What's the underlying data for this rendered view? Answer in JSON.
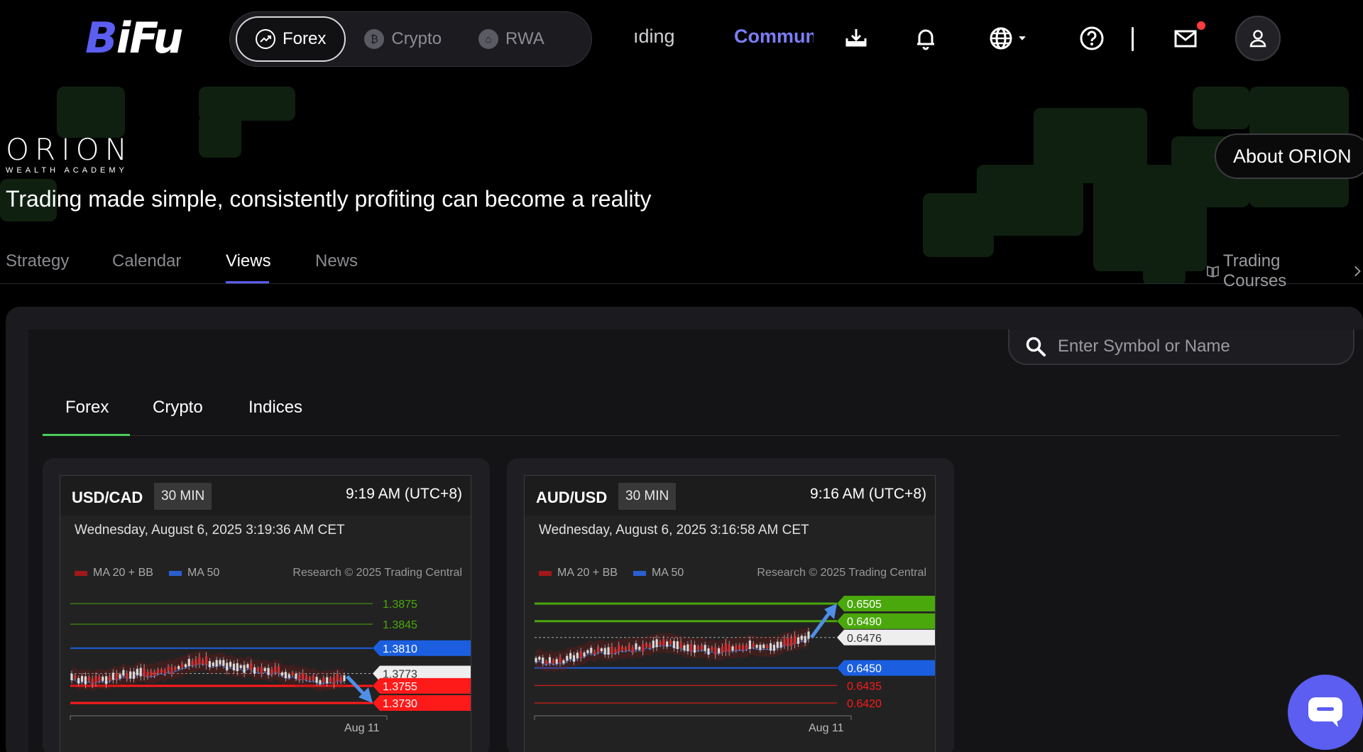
{
  "brand": {
    "logo_text_a": "B",
    "logo_text_b": "iFu"
  },
  "market_switch": [
    {
      "label": "Forex",
      "icon": "trend-icon",
      "active": true
    },
    {
      "label": "Crypto",
      "icon": "bitcoin-icon",
      "active": false
    },
    {
      "label": "RWA",
      "icon": "house-icon",
      "active": false
    }
  ],
  "nav": {
    "trading": "ıding",
    "community": "Commun"
  },
  "hero": {
    "org_name": "ORION",
    "org_sub": "WEALTH ACADEMY",
    "tagline": "Trading made simple, consistently profiting can become a reality",
    "about_button": "About ORION"
  },
  "subtabs": [
    "Strategy",
    "Calendar",
    "Views",
    "News"
  ],
  "subtab_active": "Views",
  "courses_link": "Trading Courses",
  "search": {
    "placeholder": "Enter Symbol or Name"
  },
  "category_tabs": [
    "Forex",
    "Crypto",
    "Indices"
  ],
  "category_active": "Forex",
  "cards": [
    {
      "symbol": "USD/CAD",
      "timeframe": "30 MIN",
      "time": "9:19 AM (UTC+8)",
      "date": "Wednesday, August 6, 2025 3:19:36 AM CET",
      "legend_a": "MA 20 + BB",
      "legend_b": "MA 50",
      "credit": "Research © 2025 Trading Central",
      "x_label": "Aug 11",
      "levels": [
        {
          "value": "1.3875",
          "kind": "resistance-text"
        },
        {
          "value": "1.3845",
          "kind": "resistance-text"
        },
        {
          "value": "1.3810",
          "kind": "pivot"
        },
        {
          "value": "1.3773",
          "kind": "last"
        },
        {
          "value": "1.3755",
          "kind": "support-box"
        },
        {
          "value": "1.3730",
          "kind": "support-box"
        }
      ],
      "direction": "down"
    },
    {
      "symbol": "AUD/USD",
      "timeframe": "30 MIN",
      "time": "9:16 AM (UTC+8)",
      "date": "Wednesday, August 6, 2025 3:16:58 AM CET",
      "legend_a": "MA 20 + BB",
      "legend_b": "MA 50",
      "credit": "Research © 2025 Trading Central",
      "x_label": "Aug 11",
      "levels": [
        {
          "value": "0.6505",
          "kind": "resistance-box"
        },
        {
          "value": "0.6490",
          "kind": "resistance-box"
        },
        {
          "value": "0.6476",
          "kind": "last"
        },
        {
          "value": "0.6450",
          "kind": "pivot"
        },
        {
          "value": "0.6435",
          "kind": "support-text"
        },
        {
          "value": "0.6420",
          "kind": "support-text"
        }
      ],
      "direction": "up"
    }
  ],
  "colors": {
    "accent": "#5b5ef0",
    "tab_underline": "#4ccb5a",
    "resistance": "#4aa80c",
    "support": "#ff1a1a",
    "pivot": "#1b5fe0",
    "arrow": "#4f8fe6"
  }
}
